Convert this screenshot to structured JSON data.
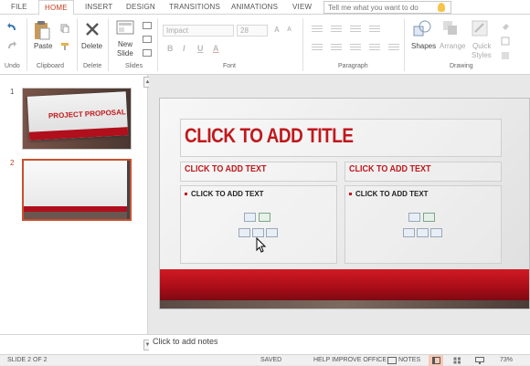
{
  "ribbon_tabs": [
    "FILE",
    "HOME",
    "INSERT",
    "DESIGN",
    "TRANSITIONS",
    "ANIMATIONS",
    "VIEW"
  ],
  "tell_me_placeholder": "Tell me what you want to do",
  "groups": {
    "undo": "Undo",
    "clipboard": "Clipboard",
    "delete": "Delete",
    "slides": "Slides",
    "font": "Font",
    "paragraph": "Paragraph",
    "drawing": "Drawing"
  },
  "buttons": {
    "paste": "Paste",
    "delete": "Delete",
    "new_slide_1": "New",
    "new_slide_2": "Slide",
    "shapes": "Shapes",
    "arrange": "Arrange",
    "quick_styles_1": "Quick",
    "quick_styles_2": "Styles"
  },
  "font_name": "Impact",
  "font_size": "28",
  "font_buttons": [
    "B",
    "I",
    "U",
    "A"
  ],
  "slides": [
    {
      "number": "1",
      "title": "PROJECT PROPOSAL"
    },
    {
      "number": "2",
      "title": ""
    }
  ],
  "slide": {
    "title": "CLICK TO ADD TITLE",
    "left_header": "CLICK TO ADD TEXT",
    "right_header": "CLICK TO ADD TEXT",
    "left_bullet": "CLICK TO ADD TEXT",
    "right_bullet": "CLICK TO ADD TEXT"
  },
  "notes_placeholder": "Click to add notes",
  "status": {
    "slide_indicator": "SLIDE 2 OF 2",
    "saved": "SAVED",
    "help": "HELP IMPROVE OFFICE",
    "notes": "NOTES",
    "zoom": "73%"
  },
  "colors": {
    "accent": "#c43b1d",
    "title_red": "#c1181c",
    "band_red": "#b00f1c"
  }
}
